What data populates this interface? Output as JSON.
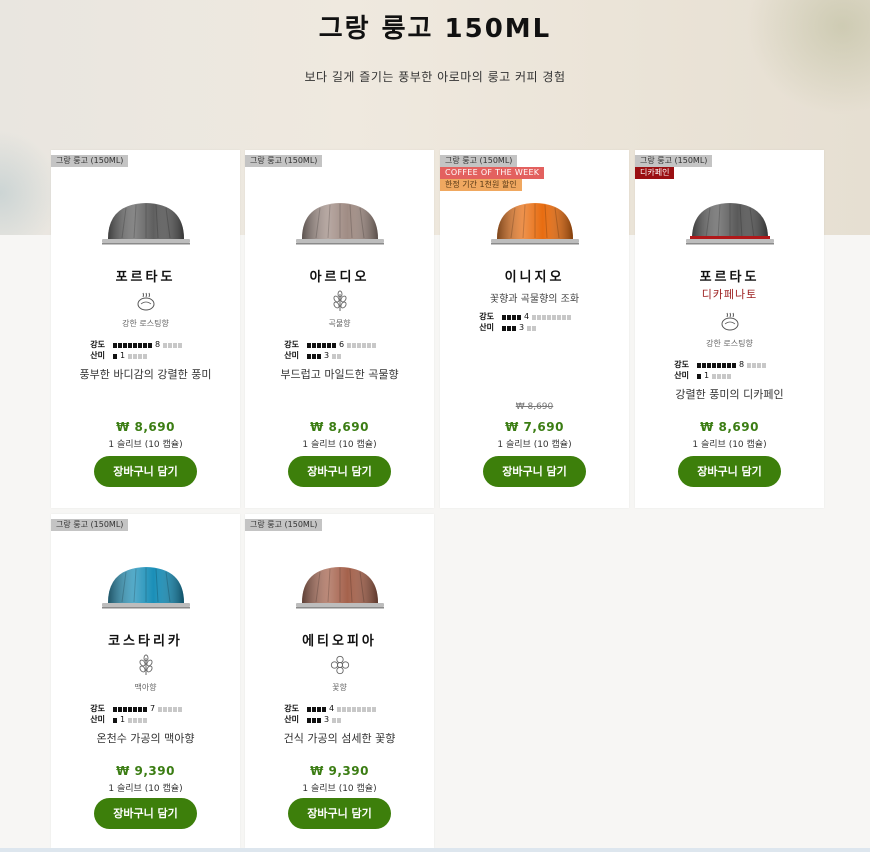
{
  "page": {
    "title": "그랑 룽고 150ML",
    "subtitle": "보다 길게 즐기는 풍부한 아로마의 룽고 커피 경험"
  },
  "products": [
    {
      "category_tag": "그랑 룽고 (150ML)",
      "name": "포르타도",
      "capsule_color": "#5f5f5f",
      "aroma_icon": "roast-cup-icon",
      "aroma_label": "강한 로스팅향",
      "intensity_label": "강도",
      "intensity": 8,
      "intensity_max": 12,
      "acidity_label": "산미",
      "acidity": 1,
      "acidity_max": 5,
      "description": "풍부한 바디감의 강렬한 풍미",
      "price": "₩ 8,690",
      "unit": "1 슬리브 (10 캡슐)",
      "cart_label": "장바구니 담기"
    },
    {
      "category_tag": "그랑 룽고 (150ML)",
      "name": "아르디오",
      "capsule_color": "#a08c84",
      "aroma_icon": "grain-icon",
      "aroma_label": "곡물향",
      "intensity_label": "강도",
      "intensity": 6,
      "intensity_max": 12,
      "acidity_label": "산미",
      "acidity": 3,
      "acidity_max": 5,
      "description": "부드럽고 마일드한 곡물향",
      "price": "₩ 8,690",
      "unit": "1 슬리브 (10 캡슐)",
      "cart_label": "장바구니 담기"
    },
    {
      "category_tag": "그랑 룽고 (150ML)",
      "badge_cotw": "COFFEE OF THE WEEK",
      "badge_promo": "한정 기간 1천원 할인",
      "name": "이니지오",
      "capsule_color": "#e86d10",
      "aroma_desc": "꽃향과 곡물향의 조화",
      "intensity_label": "강도",
      "intensity": 4,
      "intensity_max": 12,
      "acidity_label": "산미",
      "acidity": 3,
      "acidity_max": 5,
      "old_price": "₩ 8,690",
      "price": "₩ 7,690",
      "unit": "1 슬리브 (10 캡슐)",
      "cart_label": "장바구니 담기"
    },
    {
      "category_tag": "그랑 룽고 (150ML)",
      "badge_decaf": "디카페인",
      "name": "포르타도",
      "decaf_name": "디카페나토",
      "capsule_color": "#5a5a5a",
      "aroma_icon": "roast-cup-icon",
      "aroma_label": "강한 로스팅향",
      "intensity_label": "강도",
      "intensity": 8,
      "intensity_max": 12,
      "acidity_label": "산미",
      "acidity": 1,
      "acidity_max": 5,
      "description": "강렬한 풍미의 디카페인",
      "price": "₩ 8,690",
      "unit": "1 슬리브 (10 캡슐)",
      "cart_label": "장바구니 담기"
    },
    {
      "category_tag": "그랑 룽고 (150ML)",
      "name": "코스타리카",
      "capsule_color": "#1a8fb8",
      "aroma_icon": "grain-icon",
      "aroma_label": "맥아향",
      "intensity_label": "강도",
      "intensity": 7,
      "intensity_max": 12,
      "acidity_label": "산미",
      "acidity": 1,
      "acidity_max": 5,
      "description": "온천수 가공의 맥아향",
      "price": "₩ 9,390",
      "unit": "1 슬리브 (10 캡슐)",
      "cart_label": "장바구니 담기"
    },
    {
      "category_tag": "그랑 룽고 (150ML)",
      "name": "에티오피아",
      "capsule_color": "#a5624c",
      "aroma_icon": "flower-icon",
      "aroma_label": "꽃향",
      "intensity_label": "강도",
      "intensity": 4,
      "intensity_max": 12,
      "acidity_label": "산미",
      "acidity": 3,
      "acidity_max": 5,
      "description": "건식 가공의 섬세한 꽃향",
      "price": "₩ 9,390",
      "unit": "1 슬리브 (10 캡슐)",
      "cart_label": "장바구니 담기"
    }
  ]
}
